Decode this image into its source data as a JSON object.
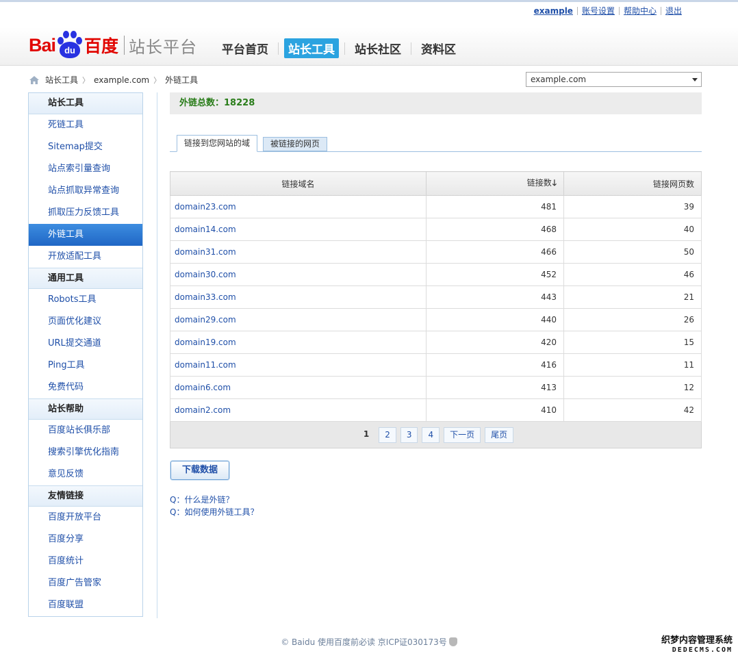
{
  "toplinks": {
    "user": "example",
    "account": "账号设置",
    "help": "帮助中心",
    "logout": "退出"
  },
  "logo": {
    "bai": "Bai",
    "du": "du",
    "baidu_cn": "百度",
    "subtitle": "站长平台"
  },
  "mainnav": [
    "平台首页",
    "站长工具",
    "站长社区",
    "资料区"
  ],
  "breadcrumb": [
    "站长工具",
    "example.com",
    "外链工具"
  ],
  "site_select": {
    "value": "example.com"
  },
  "sidebar": [
    {
      "heading": "站长工具",
      "items": [
        "死链工具",
        "Sitemap提交",
        "站点索引量查询",
        "站点抓取异常查询",
        "抓取压力反馈工具",
        "外链工具",
        "开放适配工具"
      ]
    },
    {
      "heading": "通用工具",
      "items": [
        "Robots工具",
        "页面优化建议",
        "URL提交通道",
        "Ping工具",
        "免费代码"
      ]
    },
    {
      "heading": "站长帮助",
      "items": [
        "百度站长俱乐部",
        "搜索引擎优化指南",
        "意见反馈"
      ]
    },
    {
      "heading": "友情链接",
      "items": [
        "百度开放平台",
        "百度分享",
        "百度统计",
        "百度广告管家",
        "百度联盟"
      ]
    }
  ],
  "summary": {
    "label": "外链总数：",
    "value": "18228"
  },
  "tabs": [
    "链接到您网站的域",
    "被链接的网页"
  ],
  "table": {
    "headers": [
      "链接域名",
      "链接数",
      "链接网页数"
    ],
    "sort_arrow": "🡓",
    "rows": [
      [
        "domain23.com",
        "481",
        "39"
      ],
      [
        "domain14.com",
        "468",
        "40"
      ],
      [
        "domain31.com",
        "466",
        "50"
      ],
      [
        "domain30.com",
        "452",
        "46"
      ],
      [
        "domain33.com",
        "443",
        "21"
      ],
      [
        "domain29.com",
        "440",
        "26"
      ],
      [
        "domain19.com",
        "420",
        "15"
      ],
      [
        "domain11.com",
        "416",
        "11"
      ],
      [
        "domain6.com",
        "413",
        "12"
      ],
      [
        "domain2.com",
        "410",
        "42"
      ]
    ]
  },
  "pager": {
    "pages": [
      "1",
      "2",
      "3",
      "4"
    ],
    "next": "下一页",
    "last": "尾页"
  },
  "download_button": "下载数据",
  "faq": [
    "Q：什么是外链？",
    "Q：如何使用外链工具？"
  ],
  "footer": "© Baidu 使用百度前必读 京ICP证030173号",
  "watermark": {
    "line1": "织梦内容管理系统",
    "line2": "DEDECMS.COM"
  },
  "colors": {
    "accent": "#2ba3e0",
    "link": "#1f4fa8",
    "sidebar_active": "#1f66c5",
    "summary_green": "#2a7d1a",
    "logo_red": "#e10601",
    "logo_blue": "#2932e1"
  }
}
